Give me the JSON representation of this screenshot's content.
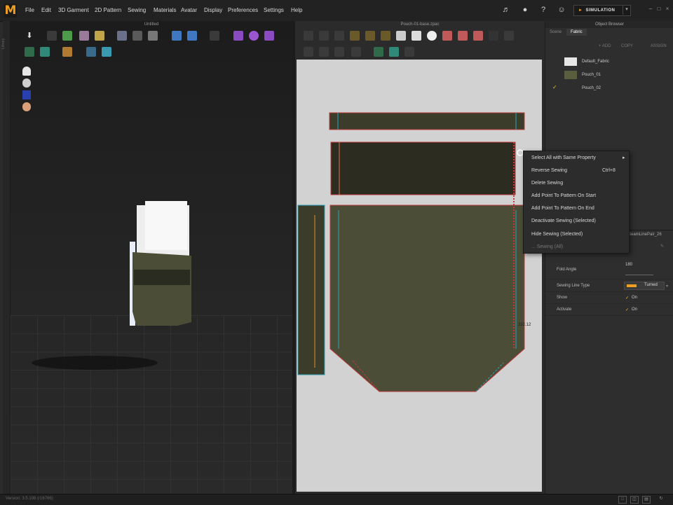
{
  "app": {
    "logo": "M"
  },
  "menu": [
    "File",
    "Edit",
    "3D Garment",
    "2D Pattern",
    "Sewing",
    "Materials",
    "Avatar",
    "Display",
    "Preferences",
    "Settings",
    "Help"
  ],
  "topbar": {
    "simulation_label": "SIMULATION"
  },
  "view3d": {
    "title": "Untitled"
  },
  "view2d": {
    "title": "Pouch-01-base.zpac",
    "measurement": "332.12"
  },
  "context_menu": {
    "items": [
      "Select All with Same Property",
      "Reverse Sewing",
      "Delete Sewing",
      "Add Point To Pattern On Start",
      "Add Point To Pattern On End",
      "Deactivate Sewing (Selected)",
      "Hide Sewing (Selected)",
      "... Sewing (All)"
    ],
    "reverse_shortcut": "Ctrl+8"
  },
  "object_browser": {
    "title": "Object Browser",
    "tabs": [
      "Scene",
      "Fabric"
    ],
    "active_tab": "Fabric",
    "actions": [
      "+ ADD",
      "COPY",
      "ASSIGN"
    ],
    "fabrics": [
      {
        "name": "Default_Fabric",
        "swatch": "#e6e6e6",
        "checked": false
      },
      {
        "name": "Pouch_01",
        "swatch": "#5a5d3e",
        "checked": false
      },
      {
        "name": "Pouch_02",
        "swatch": "#2e2e2e",
        "checked": true
      }
    ]
  },
  "property_editor": {
    "object_name": "SeamLinePair_26",
    "fold_angle_label": "Fold Angle",
    "fold_angle_value": "180",
    "sewing_line_type_label": "Sewing Line Type",
    "sewing_line_type_value": "Turned",
    "show_label": "Show",
    "show_value": "On",
    "activate_label": "Activate",
    "activate_value": "On"
  },
  "status": {
    "text": "Version: 3.5.108   (r16766)"
  },
  "colors": {
    "accent": "#f0a020",
    "fabric": "#3b3d2a",
    "pattern_bg": "#d2d2d2",
    "seam": "#c0393b",
    "seam_teal": "#2aa3b8"
  }
}
